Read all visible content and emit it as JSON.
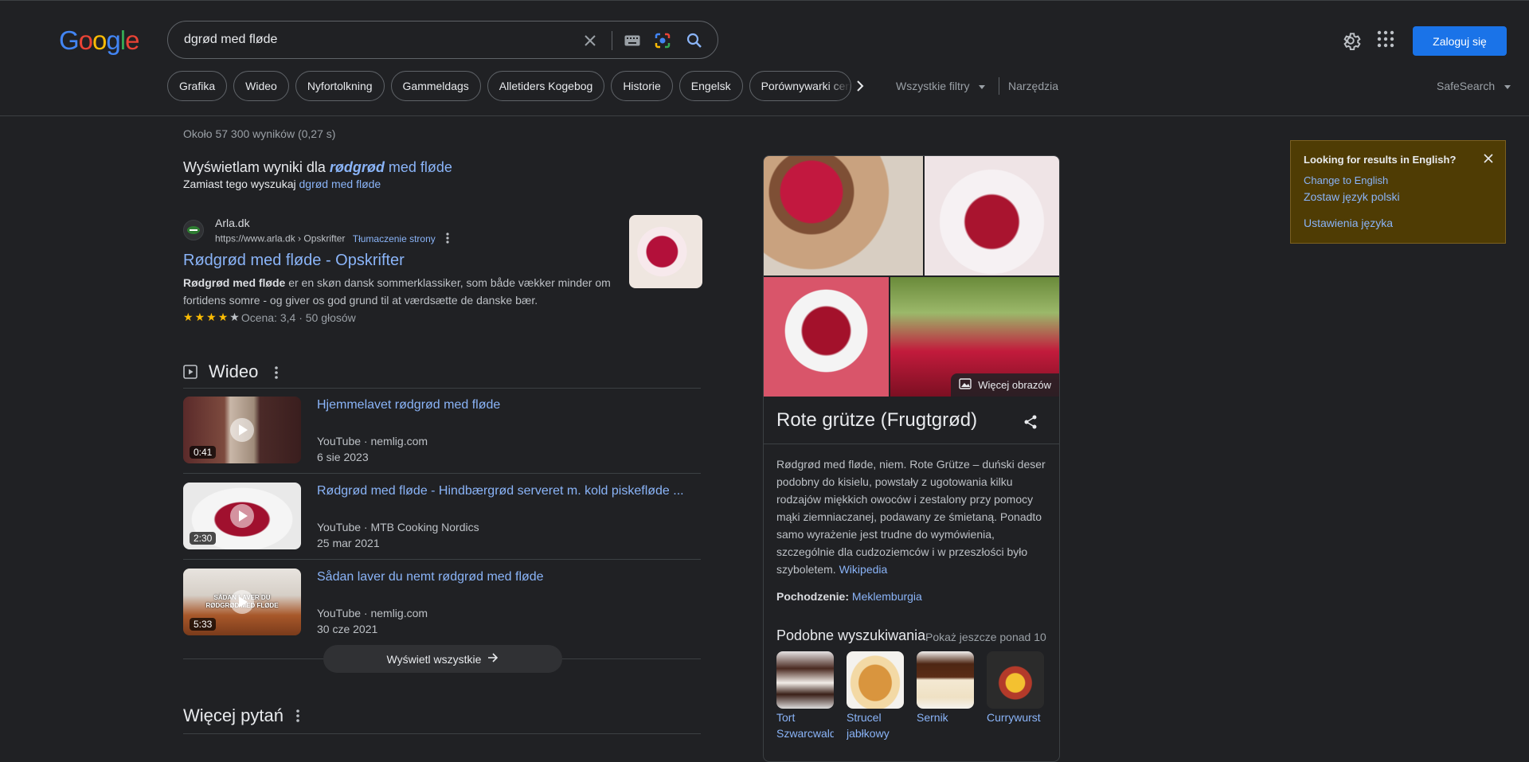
{
  "header": {
    "logo": [
      "G",
      "o",
      "o",
      "g",
      "l",
      "e"
    ],
    "query": "dgrød med fløde",
    "login_label": "Zaloguj się"
  },
  "chips": [
    "Grafika",
    "Wideo",
    "Nyfortolkning",
    "Gammeldags",
    "Alletiders Kogebog",
    "Historie",
    "Engelsk",
    "Porównywarki cen"
  ],
  "filters": {
    "all_filters": "Wszystkie filtry",
    "tools": "Narzędzia",
    "safesearch": "SafeSearch"
  },
  "stats": "Około 57 300 wyników (0,27 s)",
  "correction": {
    "prefix": "Wyświetlam wyniki dla",
    "corrected_bold": "rødgrød",
    "corrected_rest": "med fløde",
    "instead_prefix": "Zamiast tego wyszukaj",
    "instead_query": "dgrød med fløde"
  },
  "result": {
    "site": "Arla.dk",
    "url": "https://www.arla.dk › Opskrifter",
    "translate": "Tłumaczenie strony",
    "title": "Rødgrød med fløde - Opskrifter",
    "snippet_bold": "Rødgrød med fløde",
    "snippet_rest": " er en skøn dansk sommerklassiker, som både vækker minder om fortidens somre - og giver os god grund til at værdsætte de danske bær.",
    "rating_text": "Ocena: 3,4 · 50 głosów",
    "rating": 3.4
  },
  "videos": {
    "heading": "Wideo",
    "items": [
      {
        "title": "Hjemmelavet rødgrød med fløde",
        "source": "YouTube · nemlig.com",
        "date": "6 sie 2023",
        "duration": "0:41"
      },
      {
        "title": "Rødgrød med fløde - Hindbærgrød serveret m. kold piskefløde ...",
        "source": "YouTube · MTB Cooking Nordics",
        "date": "25 mar 2021",
        "duration": "2:30"
      },
      {
        "title": "Sådan laver du nemt rødgrød med fløde",
        "source": "YouTube · nemlig.com",
        "date": "30 cze 2021",
        "duration": "5:33",
        "overlay_line1": "SÅDAN LAVER DU",
        "overlay_line2": "RØDGRØD MED FLØDE"
      }
    ],
    "show_all": "Wyświetl wszystkie"
  },
  "paa": {
    "heading": "Więcej pytań"
  },
  "knowledge_panel": {
    "more_images": "Więcej obrazów",
    "title": "Rote grütze (Frugtgrød)",
    "description": "Rødgrød med fløde, niem. Rote Grütze – duński deser podobny do kisielu, powstały z ugotowania kilku rodzajów miękkich owoców i zestalony przy pomocy mąki ziemniaczanej, podawany ze śmietaną. Ponadto samo wyrażenie jest trudne do wymówienia, szczególnie dla cudzoziemców i w przeszłości było szyboletem.",
    "wiki_link": "Wikipedia",
    "origin_label": "Pochodzenie:",
    "origin_value": "Meklemburgia",
    "similar_heading": "Podobne wyszukiwania",
    "similar_more": "Pokaż jeszcze ponad 10",
    "similar": [
      {
        "line1": "Tort",
        "line2": "Szwarcwaldzki"
      },
      {
        "line1": "Strucel",
        "line2": "jabłkowy"
      },
      {
        "line1": "Sernik",
        "line2": ""
      },
      {
        "line1": "Currywurst",
        "line2": ""
      }
    ]
  },
  "language_box": {
    "title": "Looking for results in English?",
    "change": "Change to English",
    "keep": "Zostaw język polski",
    "settings": "Ustawienia języka"
  },
  "colors": {
    "background": "#202124",
    "link": "#8ab4f8",
    "primary_button": "#1a73e8",
    "lang_box": "#4f3c04"
  }
}
